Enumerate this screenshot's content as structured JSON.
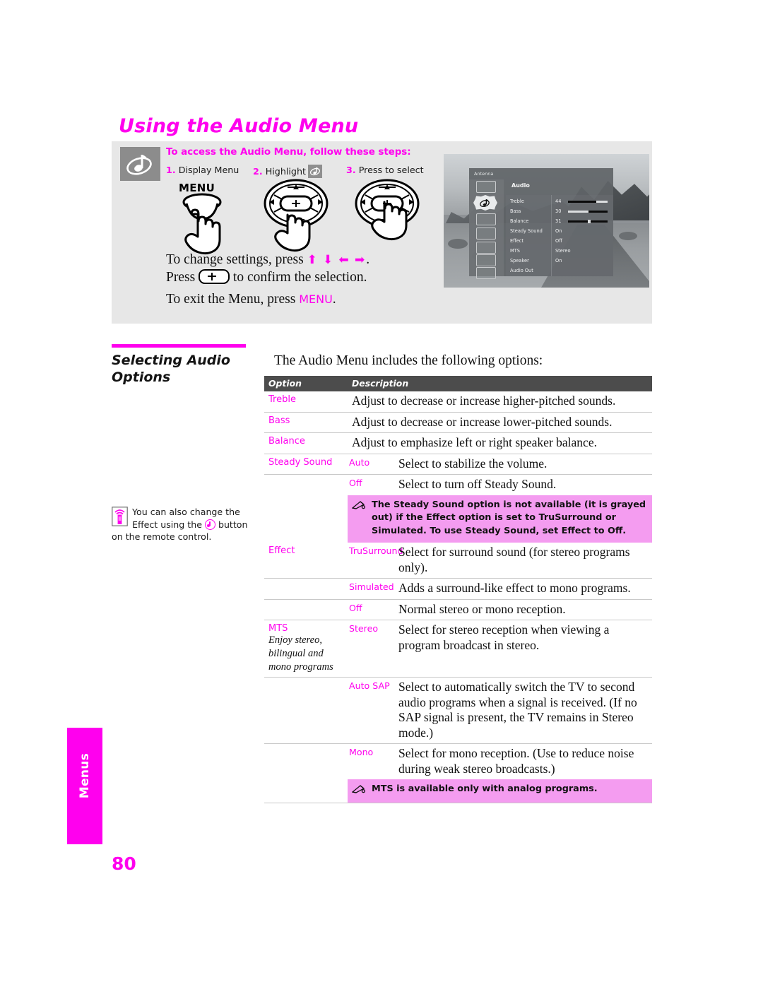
{
  "page": {
    "title": "Using the Audio Menu",
    "folio": "80",
    "tab_label": "Menus",
    "accent_color": "#ff00ee",
    "note_bg_color": "#f49cf0",
    "panel_bg_color": "#e7e7e7",
    "table_header_color": "#4c4c4c"
  },
  "intro_panel": {
    "badge_icon": "audio-note-icon",
    "steps_heading": "To access the Audio Menu, follow these steps:",
    "steps": [
      {
        "num": "1.",
        "label": "Display Menu",
        "art": "menu-button-press-icon"
      },
      {
        "num": "2.",
        "label": "Highlight",
        "icon": "audio-note-icon",
        "art": "dpad-down-press-icon"
      },
      {
        "num": "3.",
        "label": "Press to select",
        "art": "dpad-center-press-icon"
      }
    ],
    "menu_button_label": "MENU",
    "line1_a": "To change settings, press ",
    "line1_arrows": "⬆ ⬇ ⬅ ➡",
    "line1_b": ".",
    "line2_a": "Press ",
    "line2_b": " to confirm the selection.",
    "line3_a": "To exit the Menu, press ",
    "line3_menu": "MENU",
    "line3_b": "."
  },
  "tv_screen": {
    "antenna_label": "Antenna",
    "menu_title": "Audio",
    "sidebar_icons": [
      "video-icon",
      "audio-icon",
      "screen-icon",
      "pip-icon",
      "parental-lock-icon",
      "setup-toolbox-icon",
      "grid-apps-icon"
    ],
    "selected_icon_index": 1,
    "rows": [
      {
        "label": "Treble",
        "value": "44",
        "bar": 72
      },
      {
        "label": "Bass",
        "value": "30",
        "bar": 52
      },
      {
        "label": "Balance",
        "value": "31",
        "bar": 50
      },
      {
        "label": "Steady Sound",
        "value": "On",
        "bar": null
      },
      {
        "label": "Effect",
        "value": "Off",
        "bar": null
      },
      {
        "label": "MTS",
        "value": "Stereo",
        "bar": null
      },
      {
        "label": "Speaker",
        "value": "On",
        "bar": null
      },
      {
        "label": "Audio Out",
        "value": "",
        "bar": null
      }
    ]
  },
  "section": {
    "heading": "Selecting Audio Options",
    "margin_note": {
      "icon": "remote-control-icon",
      "text_a": "You can also change the Effect using the ",
      "button_icon": "effect-button-icon",
      "text_b": " button on the remote control."
    }
  },
  "table": {
    "intro": "The Audio Menu includes the following options:",
    "headers": {
      "option": "Option",
      "description": "Description"
    },
    "rows": [
      {
        "type": "simple",
        "option": "Treble",
        "description": "Adjust to decrease or increase higher-pitched sounds."
      },
      {
        "type": "simple",
        "option": "Bass",
        "description": "Adjust to decrease or increase lower-pitched sounds."
      },
      {
        "type": "simple",
        "option": "Balance",
        "description": "Adjust to emphasize left or right speaker balance."
      },
      {
        "type": "valued",
        "option": "Steady Sound",
        "value": "Auto",
        "description": "Select to stabilize the volume."
      },
      {
        "type": "valued",
        "option": "",
        "value": "Off",
        "description": "Select to turn off Steady Sound."
      },
      {
        "type": "note",
        "icon": "pencil-note-icon",
        "description": "The Steady Sound option is not available (it is grayed out) if the Effect option is set to TruSurround or Simulated. To use Steady Sound, set Effect to Off."
      },
      {
        "type": "valued",
        "option": "Effect",
        "value": "TruSurround",
        "description": "Select for surround sound (for stereo programs only)."
      },
      {
        "type": "valued",
        "option": "",
        "value": "Simulated",
        "description": "Adds a surround-like effect to mono programs."
      },
      {
        "type": "valued",
        "option": "",
        "value": "Off",
        "description": "Normal stereo or mono reception."
      },
      {
        "type": "valued",
        "option": "MTS",
        "option_sub": "Enjoy stereo, bilingual and mono programs",
        "value": "Stereo",
        "description": "Select for stereo reception when viewing a program broadcast in stereo."
      },
      {
        "type": "valued",
        "option": "",
        "value": "Auto SAP",
        "description": "Select to automatically switch the TV to second audio programs when a signal is received. (If no SAP signal is present, the TV remains in Stereo mode.)"
      },
      {
        "type": "valued",
        "option": "",
        "value": "Mono",
        "description": "Select for mono reception. (Use to reduce noise during weak stereo broadcasts.)"
      },
      {
        "type": "note",
        "icon": "pencil-note-icon",
        "description": "MTS is available only with analog programs."
      }
    ]
  }
}
